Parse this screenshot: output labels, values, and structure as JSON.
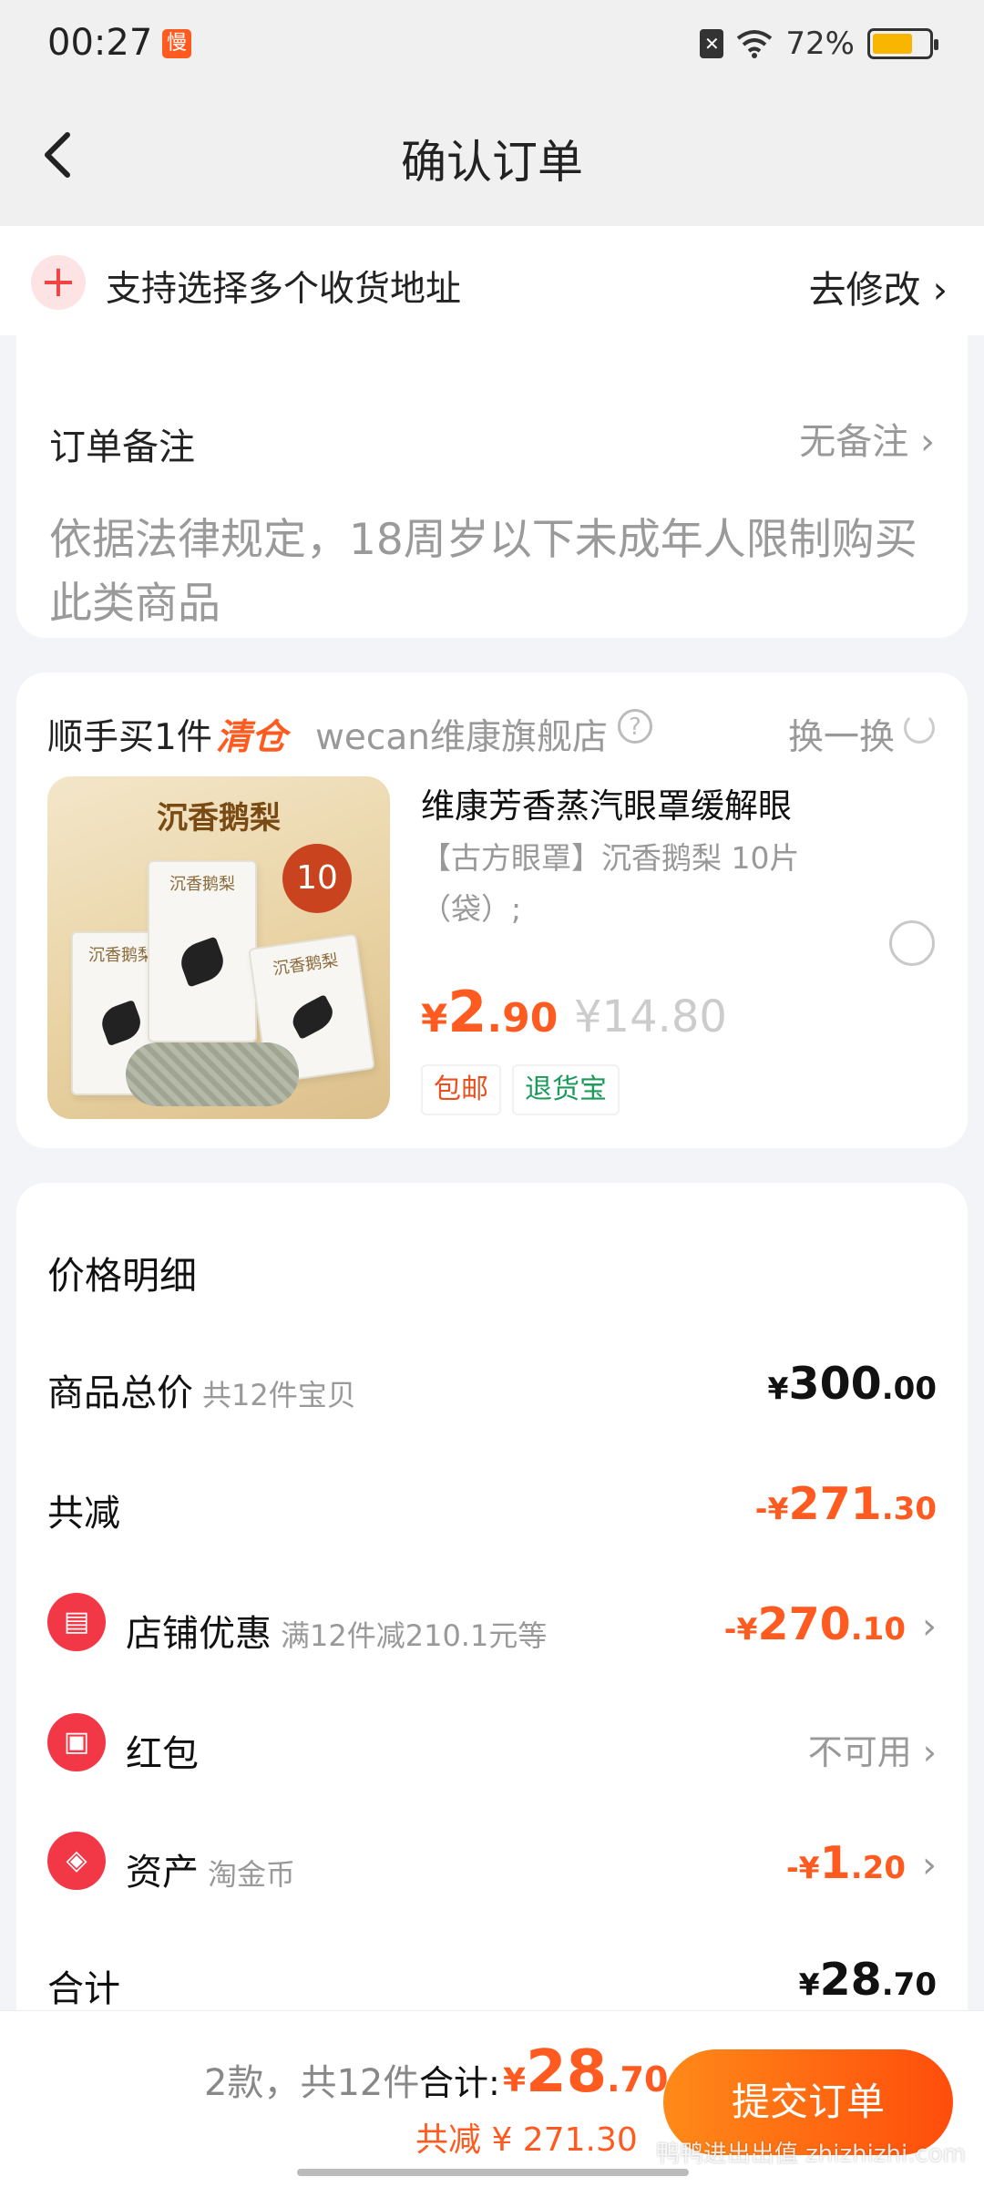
{
  "status_bar": {
    "time": "00:27",
    "app_badge": "慢",
    "sim_icon": "✕",
    "battery": "72%",
    "battery_level": 0.72
  },
  "nav": {
    "title": "确认订单"
  },
  "address": {
    "text": "支持选择多个收货地址",
    "edit_label": "去修改 ›"
  },
  "remarks": {
    "label": "订单备注",
    "value": "无备注 ›",
    "notice": "依据法律规定，18周岁以下未成年人限制购买此类商品"
  },
  "upsell": {
    "title": "顺手买1件",
    "title_highlight": "清仓",
    "store": "wecan维康旗舰店",
    "help": "?",
    "swap_label": "换一换",
    "product": {
      "image_title": "沉香鹅梨",
      "image_badge": "10",
      "image_box_label": "沉香鹅梨",
      "name": "维康芳香蒸汽眼罩缓解眼",
      "spec": "【古方眼罩】沉香鹅梨 10片（袋）;",
      "price_currency": "¥",
      "price_int": "2",
      "price_dec": ".90",
      "original_price": "¥14.80",
      "tags": [
        "包邮",
        "退货宝"
      ]
    }
  },
  "price_detail": {
    "title": "价格明细",
    "goods_total": {
      "label": "商品总价",
      "sub": "共12件宝贝",
      "cur": "¥",
      "int": "300",
      "dec": ".00"
    },
    "discount": {
      "label": "共减",
      "cur": "-¥",
      "int": "271",
      "dec": ".30"
    },
    "store_promo": {
      "icon": "store-icon",
      "label": "店铺优惠",
      "sub": "满12件减210.1元等",
      "cur": "-¥",
      "int": "270",
      "dec": ".10"
    },
    "red_packet": {
      "icon": "red-packet-icon",
      "label": "红包",
      "value": "不可用 ›"
    },
    "assets": {
      "icon": "coin-tag-icon",
      "label": "资产",
      "sub": "淘金币",
      "cur": "-¥",
      "int": "1",
      "dec": ".20"
    },
    "total": {
      "label": "合计",
      "cur": "¥",
      "int": "28",
      "dec": ".70"
    }
  },
  "footer": {
    "count": "2款，共12件",
    "total_label": "合计:",
    "total_cur": "¥",
    "total_int": "28",
    "total_dec": ".70",
    "saved": "共减 ¥ 271.30",
    "submit_label": "提交订单",
    "watermark": "鸭鸭进出出值 zhizhizhi.com"
  },
  "colors": {
    "accent": "#ff5a1f",
    "green": "#1c9a5c",
    "red_icon": "#f23846"
  }
}
